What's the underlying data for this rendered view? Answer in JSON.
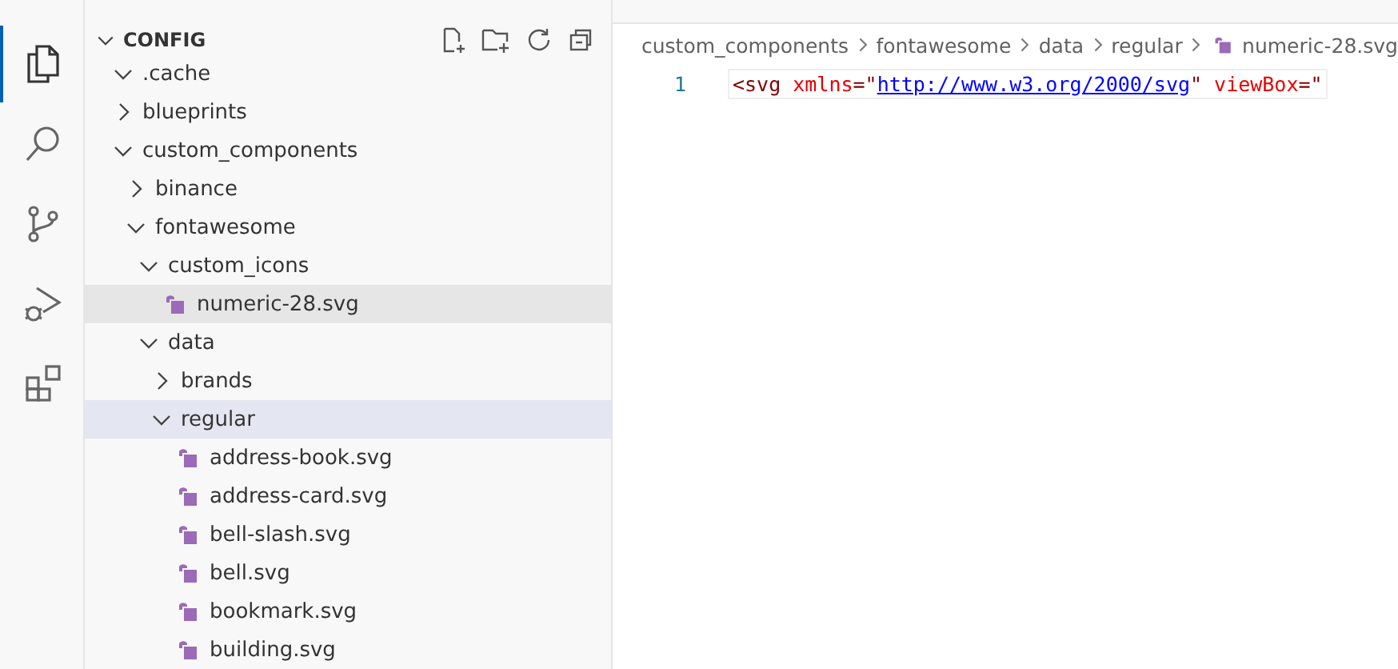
{
  "activity_bar": [
    {
      "kind": "files",
      "selected": true
    },
    {
      "kind": "search",
      "selected": false
    },
    {
      "kind": "source-control",
      "selected": false
    },
    {
      "kind": "run-debug",
      "selected": false
    },
    {
      "kind": "extensions",
      "selected": false
    }
  ],
  "explorer": {
    "root": "CONFIG",
    "expanded": true,
    "tree": [
      {
        "label": ".cache",
        "kind": "folder",
        "expanded": true,
        "selected": false,
        "hovered": false
      },
      {
        "label": "blueprints",
        "kind": "folder",
        "expanded": false,
        "selected": false,
        "hovered": false
      },
      {
        "label": "custom_components",
        "kind": "folder",
        "expanded": true,
        "selected": false,
        "hovered": false,
        "children": [
          {
            "label": "binance",
            "kind": "folder",
            "expanded": false,
            "selected": false,
            "hovered": false
          },
          {
            "label": "fontawesome",
            "kind": "folder",
            "expanded": true,
            "selected": false,
            "hovered": false,
            "children": [
              {
                "label": "custom_icons",
                "kind": "folder",
                "expanded": true,
                "selected": false,
                "hovered": false,
                "children": [
                  {
                    "label": "numeric-28.svg",
                    "kind": "file",
                    "selected": false,
                    "hovered": true
                  }
                ]
              },
              {
                "label": "data",
                "kind": "folder",
                "expanded": true,
                "selected": false,
                "hovered": false,
                "children": [
                  {
                    "label": "brands",
                    "kind": "folder",
                    "expanded": false,
                    "selected": false,
                    "hovered": false
                  },
                  {
                    "label": "regular",
                    "kind": "folder",
                    "expanded": true,
                    "selected": true,
                    "hovered": false,
                    "children": [
                      {
                        "label": "address-book.svg",
                        "kind": "file",
                        "selected": false,
                        "hovered": false
                      },
                      {
                        "label": "address-card.svg",
                        "kind": "file",
                        "selected": false,
                        "hovered": false
                      },
                      {
                        "label": "bell-slash.svg",
                        "kind": "file",
                        "selected": false,
                        "hovered": false
                      },
                      {
                        "label": "bell.svg",
                        "kind": "file",
                        "selected": false,
                        "hovered": false
                      },
                      {
                        "label": "bookmark.svg",
                        "kind": "file",
                        "selected": false,
                        "hovered": false
                      },
                      {
                        "label": "building.svg",
                        "kind": "file",
                        "selected": false,
                        "hovered": false
                      }
                    ]
                  }
                ]
              }
            ]
          }
        ]
      }
    ]
  },
  "breadcrumbs": [
    {
      "label": "custom_components",
      "kind": "folder"
    },
    {
      "label": "fontawesome",
      "kind": "folder"
    },
    {
      "label": "data",
      "kind": "folder"
    },
    {
      "label": "regular",
      "kind": "folder"
    },
    {
      "label": "numeric-28.svg",
      "kind": "file"
    }
  ],
  "editor": {
    "lines": [
      {
        "number": "1",
        "tokens": [
          {
            "text": "<",
            "kind": "punct"
          },
          {
            "text": "svg",
            "kind": "tag"
          },
          {
            "text": " xmlns",
            "kind": "attr"
          },
          {
            "text": "=\"",
            "kind": "punct"
          },
          {
            "text": "http://www.w3.org/2000/svg",
            "kind": "link"
          },
          {
            "text": "\"",
            "kind": "punct"
          },
          {
            "text": " viewBox",
            "kind": "attr"
          },
          {
            "text": "=\"",
            "kind": "punct"
          }
        ]
      }
    ]
  }
}
